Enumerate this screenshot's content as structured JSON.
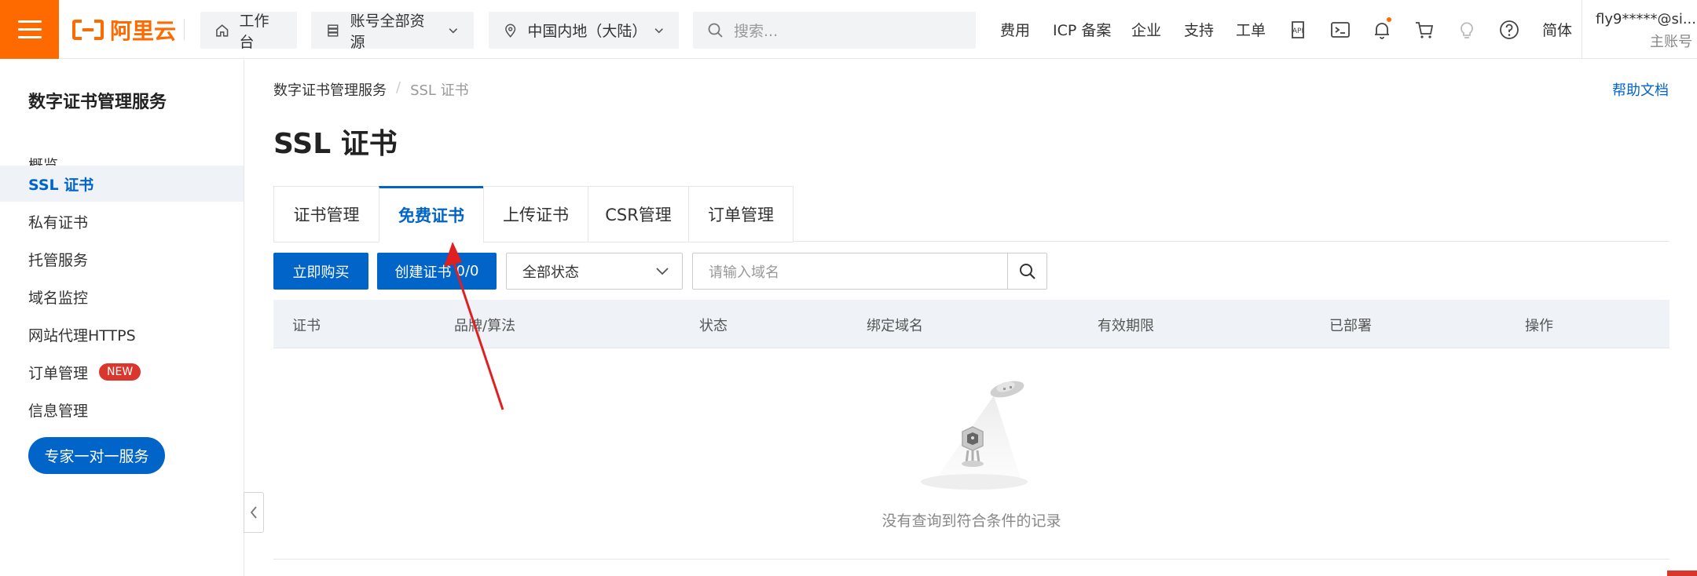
{
  "topbar": {
    "logo_text": "阿里云",
    "workbench": "工作台",
    "resources": "账号全部资源",
    "region": "中国内地（大陆）",
    "search_placeholder": "搜索...",
    "links": [
      "费用",
      "ICP 备案",
      "企业",
      "支持",
      "工单"
    ],
    "lang": "简体",
    "user_name": "fly9*****@si...",
    "user_role": "主账号",
    "brand_color": "#ff6a00"
  },
  "sidebar": {
    "title": "数字证书管理服务",
    "items": [
      {
        "label": "概览"
      },
      {
        "label": "SSL 证书"
      },
      {
        "label": "私有证书"
      },
      {
        "label": "托管服务"
      },
      {
        "label": "域名监控"
      },
      {
        "label": "网站代理HTTPS"
      },
      {
        "label": "订单管理",
        "badge": "NEW"
      },
      {
        "label": "信息管理"
      }
    ],
    "expert_button": "专家一对一服务"
  },
  "main": {
    "breadcrumb": [
      "数字证书管理服务",
      "/",
      "SSL 证书"
    ],
    "help": "帮助文档",
    "title": "SSL 证书",
    "tabs": [
      {
        "label": "证书管理"
      },
      {
        "label": "免费证书"
      },
      {
        "label": "上传证书"
      },
      {
        "label": "CSR管理"
      },
      {
        "label": "订单管理"
      }
    ],
    "active_tab": "免费证书",
    "buy_button": "立即购买",
    "create_button": "创建证书",
    "create_count": "0/0",
    "status_select": "全部状态",
    "domain_placeholder": "请输入域名",
    "columns": [
      "证书",
      "品牌/算法",
      "状态",
      "绑定域名",
      "有效期限",
      "已部署",
      "操作"
    ],
    "empty_text": "没有查询到符合条件的记录",
    "accent_color": "#0064c8"
  }
}
